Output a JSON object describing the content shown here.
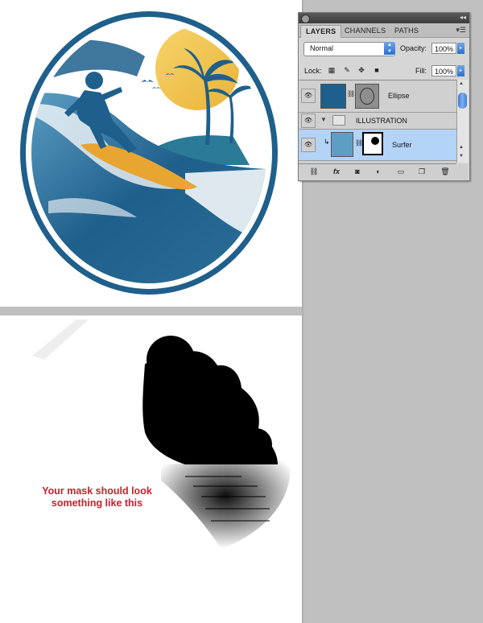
{
  "caption": {
    "line1": "Your mask should look",
    "line2": "something like this"
  },
  "panel": {
    "tabs": [
      "LAYERS",
      "CHANNELS",
      "PATHS"
    ],
    "active_tab": "LAYERS",
    "blend_mode": "Normal",
    "opacity_label": "Opacity:",
    "opacity_value": "100%",
    "lock_label": "Lock:",
    "fill_label": "Fill:",
    "fill_value": "100%",
    "layers": [
      {
        "name": "Ellipse",
        "type": "shape-layer",
        "visible": true
      },
      {
        "name": "ILLUSTRATION",
        "type": "group",
        "visible": true,
        "expanded": true
      },
      {
        "name": "Surfer",
        "type": "clipped-layer-with-mask",
        "visible": true,
        "selected": true
      }
    ],
    "bottom_icons": [
      "link-icon",
      "fx-icon",
      "add-mask-icon",
      "adjustment-layer-icon",
      "new-group-icon",
      "new-layer-icon",
      "trash-icon"
    ]
  },
  "colors": {
    "ring": "#1f5f8b",
    "sun": "#f2c24a",
    "board": "#e9a531",
    "caption": "#cc1f2a",
    "selected_row": "#b3d3f7"
  }
}
